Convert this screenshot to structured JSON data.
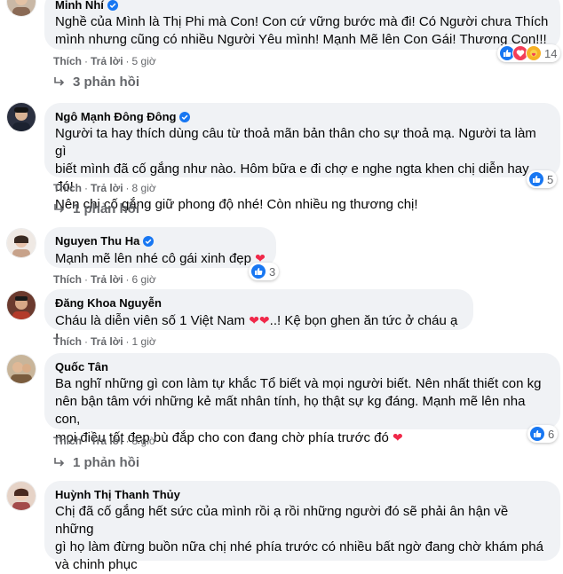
{
  "common": {
    "like_label": "Thích",
    "reply_label": "Trả lời",
    "dot": "·"
  },
  "comments": [
    {
      "name": "Minh Nhí",
      "verified": true,
      "lines": [
        "Nghề của Mình là Thị Phi mà Con! Con cứ vững bước mà đi! Có Người chưa Thích",
        "mình nhưng cũng có nhiều Người Yêu mình! Mạnh Mẽ lên Con Gái! Thương Con!!!"
      ],
      "time": "5 giờ",
      "reactions": [
        "like",
        "love",
        "care"
      ],
      "reaction_count": "14",
      "replies": "3 phản hồi"
    },
    {
      "name": "Ngô Mạnh Đông Đông",
      "verified": true,
      "lines": [
        "Người ta hay thích dùng câu từ thoả mãn bản thân cho sự thoả mạ. Người ta làm gì",
        "biết mình đã cố gắng như nào. Hôm bữa e đi chợ e nghe ngta khen chị diễn hay đó!",
        "Nên chị cố gắng giữ phong độ nhé! Còn nhiều ng thương chị!"
      ],
      "time": "8 giờ",
      "reactions": [
        "like"
      ],
      "reaction_count": "5",
      "replies": "1 phản hồi"
    },
    {
      "name": "Nguyen Thu Ha",
      "verified": true,
      "lines": [
        "Mạnh mẽ lên nhé cô gái xinh đẹp"
      ],
      "hearts": "❤",
      "time": "6 giờ",
      "reactions": [
        "like"
      ],
      "reaction_count": "3"
    },
    {
      "name": "Đăng Khoa Nguyễn",
      "verified": false,
      "line_prefix": "Cháu là diễn viên số 1 Việt Nam ",
      "hearts": "❤❤",
      "line_suffix": "..! Kệ bọn ghen ăn tức ở cháu ạ !",
      "time": "1 giờ"
    },
    {
      "name": "Quốc Tân",
      "verified": false,
      "lines": [
        "Ba nghĩ những gì con làm tự khắc Tổ biết và mọi người biết. Nên nhất thiết con kg",
        "nên bận tâm với những kẻ mất nhân tính, họ thật sự kg đáng. Mạnh mẽ lên nha con,",
        "mọi điều tốt đẹp bù đắp cho con đang chờ phía trước đó"
      ],
      "hearts": "❤",
      "time": "8 giờ",
      "reactions": [
        "like"
      ],
      "reaction_count": "6",
      "replies": "1 phản hồi"
    },
    {
      "name": "Huỳnh Thị Thanh Thủy",
      "verified": false,
      "lines": [
        "Chị đã cố gắng hết sức của mình rồi ạ rồi những người đó sẽ phải ân hận về những",
        "gì họ làm đừng buồn nữa chị nhé phía trước có nhiều bất ngờ đang chờ khám phá",
        "và chinh phục"
      ]
    }
  ]
}
